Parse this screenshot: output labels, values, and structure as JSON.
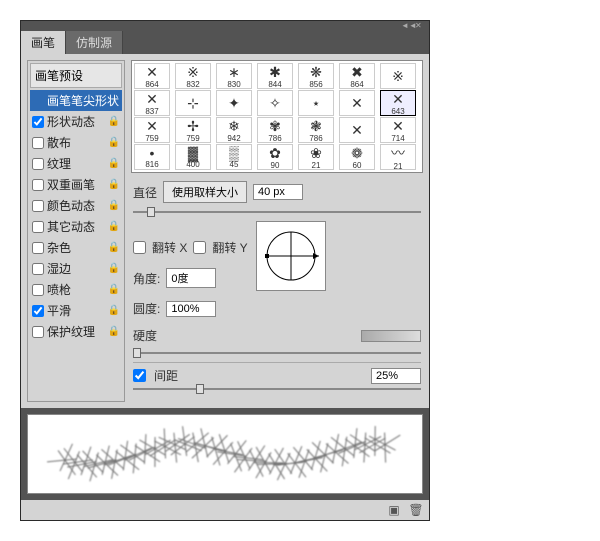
{
  "tabs": {
    "brush": "画笔",
    "clone": "仿制源"
  },
  "preset_header": "画笔预设",
  "options": [
    {
      "label": "画笔笔尖形状",
      "checked": null,
      "lock": false,
      "selected": true
    },
    {
      "label": "形状动态",
      "checked": true,
      "lock": true
    },
    {
      "label": "散布",
      "checked": false,
      "lock": true
    },
    {
      "label": "纹理",
      "checked": false,
      "lock": true
    },
    {
      "label": "双重画笔",
      "checked": false,
      "lock": true
    },
    {
      "label": "颜色动态",
      "checked": false,
      "lock": true
    },
    {
      "label": "其它动态",
      "checked": false,
      "lock": true
    },
    {
      "label": "杂色",
      "checked": false,
      "lock": true
    },
    {
      "label": "湿边",
      "checked": false,
      "lock": true
    },
    {
      "label": "喷枪",
      "checked": false,
      "lock": true
    },
    {
      "label": "平滑",
      "checked": true,
      "lock": true
    },
    {
      "label": "保护纹理",
      "checked": false,
      "lock": true
    }
  ],
  "brushes": [
    "864",
    "832",
    "830",
    "844",
    "856",
    "864",
    "",
    "837",
    "",
    "",
    "",
    "",
    "",
    "643",
    "759",
    "759",
    "942",
    "786",
    "786",
    "",
    "714",
    "816",
    "400",
    "45",
    "90",
    "21",
    "60",
    "21"
  ],
  "selected_brush_index": 13,
  "settings": {
    "diameter_label": "直径",
    "use_sample_size": "使用取样大小",
    "diameter_value": "40 px",
    "flip_x": "翻转 X",
    "flip_y": "翻转 Y",
    "angle_label": "角度:",
    "angle_value": "0度",
    "roundness_label": "圆度:",
    "roundness_value": "100%",
    "hardness_label": "硬度",
    "spacing_label": "间距",
    "spacing_value": "25%"
  }
}
